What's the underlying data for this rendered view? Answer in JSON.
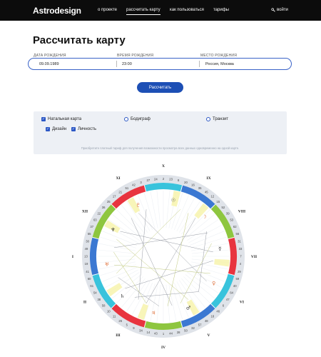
{
  "header": {
    "logo": "Astrodesign",
    "nav": [
      {
        "label": "о проекте"
      },
      {
        "label": "рассчитать карту"
      },
      {
        "label": "как пользоваться"
      },
      {
        "label": "тарифы"
      }
    ],
    "login_label": "войти"
  },
  "page": {
    "title": "Рассчитать карту"
  },
  "form": {
    "birth_date": {
      "label": "ДАТА РОЖДЕНИЯ",
      "value": "09.09.1989"
    },
    "birth_time": {
      "label": "ВРЕМЯ РОЖДЕНИЯ",
      "value": "23:00"
    },
    "birth_place": {
      "label": "МЕСТО РОЖДЕНИЯ",
      "value": "Россия, Москва"
    },
    "submit_label": "Рассчитать"
  },
  "options": {
    "natal": {
      "label": "Натальная карта",
      "checked": true
    },
    "bodygraph": {
      "label": "Бодиграф",
      "checked": false
    },
    "transit": {
      "label": "Транзит",
      "checked": false
    },
    "design": {
      "label": "Дизайн",
      "checked": true
    },
    "personality": {
      "label": "Личность",
      "checked": true
    },
    "note": "Приобретите платный тариф для получения возможности просмотра всех данных одновременно на одной карте."
  },
  "wheel": {
    "houses": [
      "I",
      "II",
      "III",
      "IV",
      "V",
      "VI",
      "VII",
      "VIII",
      "IX",
      "X",
      "XI",
      "XII"
    ],
    "numbers": [
      "2",
      "23",
      "8",
      "20",
      "16",
      "35",
      "45",
      "12",
      "15",
      "52",
      "39",
      "53",
      "62",
      "56",
      "31",
      "33",
      "7",
      "4",
      "29",
      "59",
      "40",
      "64",
      "47",
      "6",
      "46",
      "18",
      "48",
      "57",
      "32",
      "50",
      "28",
      "44",
      "1",
      "43",
      "14",
      "34",
      "9",
      "5",
      "26",
      "11",
      "10",
      "58",
      "38",
      "54",
      "61",
      "60",
      "41",
      "19",
      "13",
      "49",
      "30",
      "55",
      "37",
      "63",
      "22",
      "36",
      "25",
      "17",
      "21",
      "51",
      "42",
      "3",
      "27",
      "24"
    ],
    "colors": {
      "red": "#e8343f",
      "blue": "#3b78d2",
      "cyan": "#38c3dc",
      "green": "#8ec63f",
      "accent": "#1d4fb5"
    },
    "signs": [
      "aries-icon",
      "taurus-icon",
      "gemini-icon",
      "cancer-icon",
      "leo-icon",
      "virgo-icon",
      "libra-icon",
      "scorpio-icon",
      "sagittarius-icon",
      "capricorn-icon",
      "aquarius-icon",
      "pisces-icon"
    ],
    "planet_glyphs": [
      "☉",
      "☽",
      "☿",
      "♀",
      "♂",
      "♃",
      "♄",
      "♅",
      "♆",
      "♇"
    ]
  }
}
